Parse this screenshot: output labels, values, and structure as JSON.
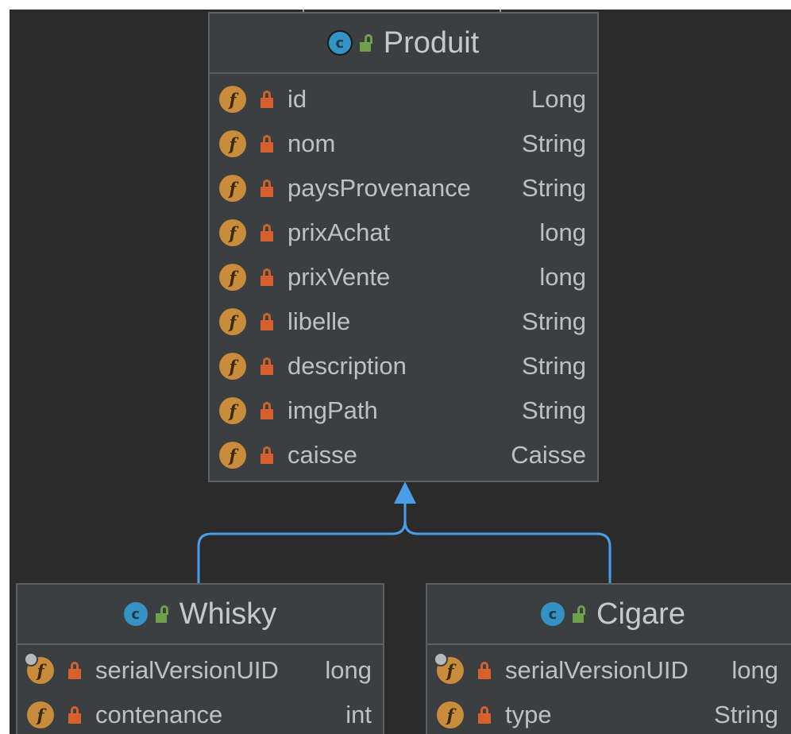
{
  "colors": {
    "background": "#2b2b2b",
    "class_fill": "#3c3f41",
    "class_border": "#5d5f61",
    "class_icon": "#3592c4",
    "field_icon": "#c88c3a",
    "private_lock": "#d6612f",
    "public_lock": "#6fa04b",
    "inheritance_arrow": "#4a9ee8"
  },
  "classes": {
    "produit": {
      "name": "Produit",
      "icon": "class-icon",
      "fields": [
        {
          "name": "id",
          "type": "Long"
        },
        {
          "name": "nom",
          "type": "String"
        },
        {
          "name": "paysProvenance",
          "type": "String"
        },
        {
          "name": "prixAchat",
          "type": "long"
        },
        {
          "name": "prixVente",
          "type": "long"
        },
        {
          "name": "libelle",
          "type": "String"
        },
        {
          "name": "description",
          "type": "String"
        },
        {
          "name": "imgPath",
          "type": "String"
        },
        {
          "name": "caisse",
          "type": "Caisse"
        }
      ]
    },
    "whisky": {
      "name": "Whisky",
      "icon": "class-icon",
      "fields": [
        {
          "name": "serialVersionUID",
          "type": "long"
        },
        {
          "name": "contenance",
          "type": "int"
        }
      ]
    },
    "cigare": {
      "name": "Cigare",
      "icon": "class-icon",
      "fields": [
        {
          "name": "serialVersionUID",
          "type": "long"
        },
        {
          "name": "type",
          "type": "String"
        }
      ]
    }
  },
  "relations": [
    {
      "type": "inheritance",
      "from": "Whisky",
      "to": "Produit"
    },
    {
      "type": "inheritance",
      "from": "Cigare",
      "to": "Produit"
    }
  ]
}
